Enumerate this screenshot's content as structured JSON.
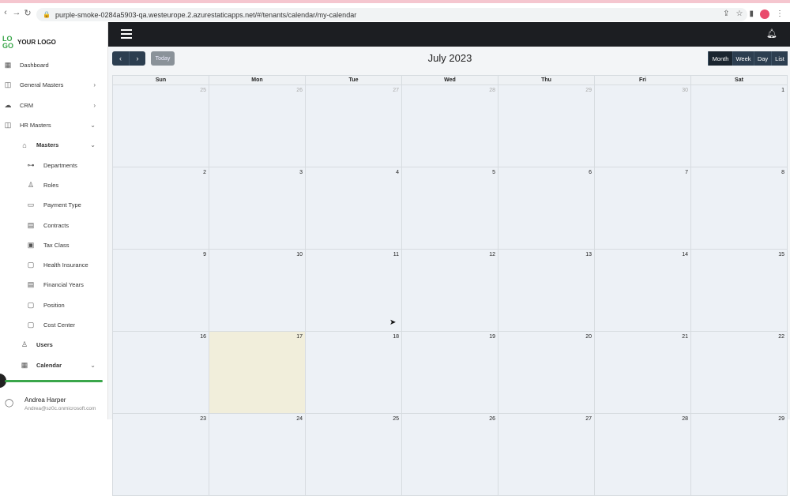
{
  "browser": {
    "url": "purple-smoke-0284a5903-qa.westeurope.2.azurestaticapps.net/#/tenants/calendar/my-calendar"
  },
  "sidebar": {
    "logo_mark": "LOGO",
    "logo_text": "YOUR LOGO",
    "items": [
      {
        "label": "Dashboard",
        "icon": "dashboard-icon",
        "level": 0,
        "chevron": ""
      },
      {
        "label": "General Masters",
        "icon": "masters-icon",
        "level": 0,
        "chevron": "›"
      },
      {
        "label": "CRM",
        "icon": "crm-icon",
        "level": 0,
        "chevron": "›"
      },
      {
        "label": "HR Masters",
        "icon": "hr-icon",
        "level": 0,
        "chevron": "⌄"
      },
      {
        "label": "Masters",
        "icon": "home-icon",
        "level": 1,
        "chevron": "⌄"
      },
      {
        "label": "Departments",
        "icon": "departments-icon",
        "level": 2,
        "chevron": ""
      },
      {
        "label": "Roles",
        "icon": "user-icon",
        "level": 2,
        "chevron": ""
      },
      {
        "label": "Payment Type",
        "icon": "payment-icon",
        "level": 2,
        "chevron": ""
      },
      {
        "label": "Contracts",
        "icon": "contract-icon",
        "level": 2,
        "chevron": ""
      },
      {
        "label": "Tax Class",
        "icon": "tax-icon",
        "level": 2,
        "chevron": ""
      },
      {
        "label": "Health Insurance",
        "icon": "clipboard-icon",
        "level": 2,
        "chevron": ""
      },
      {
        "label": "Financial Years",
        "icon": "ledger-icon",
        "level": 2,
        "chevron": ""
      },
      {
        "label": "Position",
        "icon": "clipboard-icon",
        "level": 2,
        "chevron": ""
      },
      {
        "label": "Cost Center",
        "icon": "clipboard-icon",
        "level": 2,
        "chevron": ""
      },
      {
        "label": "Users",
        "icon": "users-icon",
        "level": 1,
        "chevron": ""
      },
      {
        "label": "Calendar",
        "icon": "calendar-icon",
        "level": 1,
        "chevron": "⌄"
      }
    ],
    "user": {
      "name": "Andrea Harper",
      "email": "Andrea@sz0c.onmicrosoft.com"
    }
  },
  "calendar": {
    "title": "July 2023",
    "today_label": "Today",
    "prev_label": "‹",
    "next_label": "›",
    "views": [
      "Month",
      "Week",
      "Day",
      "List"
    ],
    "active_view": "Month",
    "weekdays": [
      "Sun",
      "Mon",
      "Tue",
      "Wed",
      "Thu",
      "Fri",
      "Sat"
    ],
    "weeks": [
      [
        {
          "d": "25",
          "o": true
        },
        {
          "d": "26",
          "o": true
        },
        {
          "d": "27",
          "o": true
        },
        {
          "d": "28",
          "o": true
        },
        {
          "d": "29",
          "o": true
        },
        {
          "d": "30",
          "o": true
        },
        {
          "d": "1",
          "o": false
        }
      ],
      [
        {
          "d": "2",
          "o": false
        },
        {
          "d": "3",
          "o": false
        },
        {
          "d": "4",
          "o": false
        },
        {
          "d": "5",
          "o": false
        },
        {
          "d": "6",
          "o": false
        },
        {
          "d": "7",
          "o": false
        },
        {
          "d": "8",
          "o": false
        }
      ],
      [
        {
          "d": "9",
          "o": false
        },
        {
          "d": "10",
          "o": false
        },
        {
          "d": "11",
          "o": false
        },
        {
          "d": "12",
          "o": false
        },
        {
          "d": "13",
          "o": false
        },
        {
          "d": "14",
          "o": false
        },
        {
          "d": "15",
          "o": false
        }
      ],
      [
        {
          "d": "16",
          "o": false
        },
        {
          "d": "17",
          "o": false,
          "today": true
        },
        {
          "d": "18",
          "o": false
        },
        {
          "d": "19",
          "o": false
        },
        {
          "d": "20",
          "o": false
        },
        {
          "d": "21",
          "o": false
        },
        {
          "d": "22",
          "o": false
        }
      ],
      [
        {
          "d": "23",
          "o": false
        },
        {
          "d": "24",
          "o": false
        },
        {
          "d": "25",
          "o": false
        },
        {
          "d": "26",
          "o": false
        },
        {
          "d": "27",
          "o": false
        },
        {
          "d": "28",
          "o": false
        },
        {
          "d": "29",
          "o": false
        }
      ]
    ]
  }
}
